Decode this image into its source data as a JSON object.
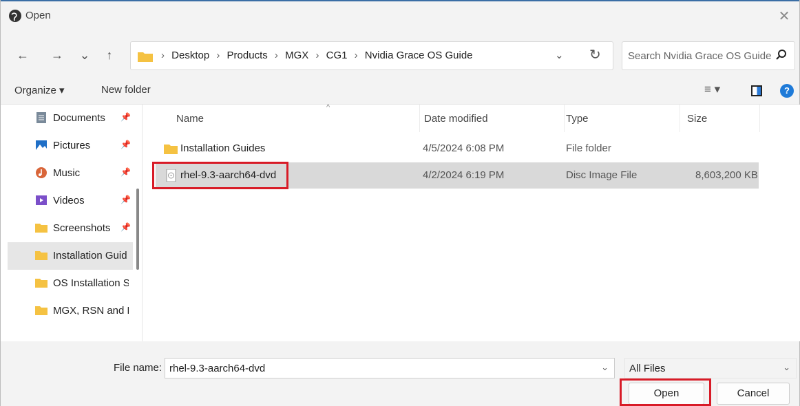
{
  "window": {
    "title": "Open",
    "close_glyph": "✕"
  },
  "nav": {
    "back": "←",
    "forward": "→",
    "recent": "⌄",
    "up": "↑",
    "breadcrumbs": [
      "Desktop",
      "Products",
      "MGX",
      "CG1",
      "Nvidia Grace OS Guide"
    ],
    "separator": "›",
    "dropdown": "⌄",
    "refresh": "↻"
  },
  "search": {
    "placeholder": "Search Nvidia Grace OS Guide"
  },
  "toolbar": {
    "organize": "Organize ▾",
    "new_folder": "New folder",
    "view": "≡ ▾",
    "help": "?"
  },
  "sidebar": {
    "pin": "📌",
    "items": [
      {
        "label": "Documents",
        "icon": "documents-icon",
        "pinned": true
      },
      {
        "label": "Pictures",
        "icon": "pictures-icon",
        "pinned": true
      },
      {
        "label": "Music",
        "icon": "music-icon",
        "pinned": true
      },
      {
        "label": "Videos",
        "icon": "videos-icon",
        "pinned": true
      },
      {
        "label": "Screenshots",
        "icon": "folder-icon",
        "pinned": true
      },
      {
        "label": "Installation Guid",
        "icon": "folder-icon",
        "selected": true
      },
      {
        "label": "OS Installation S",
        "icon": "folder-icon"
      },
      {
        "label": "MGX, RSN and F",
        "icon": "folder-icon"
      }
    ]
  },
  "columns": {
    "name": "Name",
    "date": "Date modified",
    "type": "Type",
    "size": "Size",
    "sort_caret": "^"
  },
  "files": [
    {
      "name": "Installation Guides",
      "date": "4/5/2024 6:08 PM",
      "type": "File folder",
      "size": "",
      "icon": "folder-icon"
    },
    {
      "name": "rhel-9.3-aarch64-dvd",
      "date": "4/2/2024 6:19 PM",
      "type": "Disc Image File",
      "size": "8,603,200 KB",
      "icon": "disc-image-icon",
      "selected": true
    }
  ],
  "footer": {
    "file_name_label": "File name:",
    "file_name_value": "rhel-9.3-aarch64-dvd",
    "file_type": "All Files",
    "dropdown": "⌄",
    "open": "Open",
    "cancel": "Cancel"
  },
  "colors": {
    "highlight": "#d81b27",
    "folder": "#f5c242",
    "accent": "#1e7ad8"
  }
}
